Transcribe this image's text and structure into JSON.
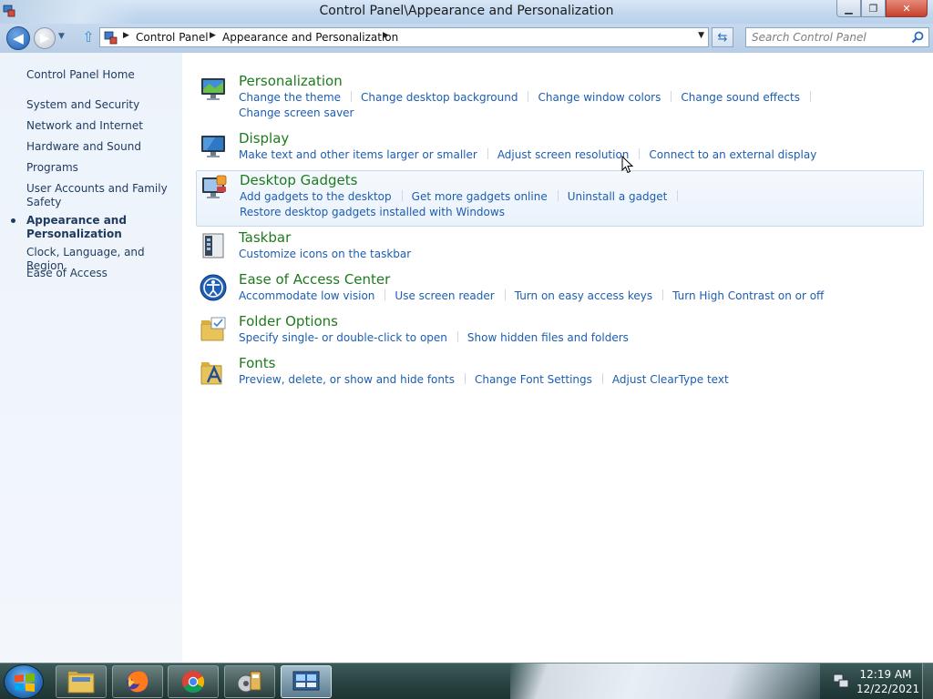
{
  "window": {
    "title": "Control Panel\\Appearance and Personalization"
  },
  "address_bar": {
    "crumbs": [
      "Control Panel",
      "Appearance and Personalization"
    ],
    "search_placeholder": "Search Control Panel"
  },
  "sidebar": {
    "items": [
      {
        "label": "Control Panel Home",
        "current": false
      },
      {
        "label": "System and Security",
        "current": false
      },
      {
        "label": "Network and Internet",
        "current": false
      },
      {
        "label": "Hardware and Sound",
        "current": false
      },
      {
        "label": "Programs",
        "current": false
      },
      {
        "label": "User Accounts and Family Safety",
        "current": false
      },
      {
        "label": "Appearance and Personalization",
        "current": true
      },
      {
        "label": "Clock, Language, and Region",
        "current": false
      },
      {
        "label": "Ease of Access",
        "current": false
      }
    ]
  },
  "categories": [
    {
      "title": "Personalization",
      "icon": "personalization-icon",
      "links": [
        "Change the theme",
        "Change desktop background",
        "Change window colors",
        "Change sound effects",
        "Change screen saver"
      ]
    },
    {
      "title": "Display",
      "icon": "display-icon",
      "links": [
        "Make text and other items larger or smaller",
        "Adjust screen resolution",
        "Connect to an external display"
      ]
    },
    {
      "title": "Desktop Gadgets",
      "icon": "gadgets-icon",
      "hover": true,
      "links": [
        "Add gadgets to the desktop",
        "Get more gadgets online",
        "Uninstall a gadget",
        "Restore desktop gadgets installed with Windows"
      ]
    },
    {
      "title": "Taskbar",
      "icon": "taskbar-icon",
      "links": [
        "Customize icons on the taskbar"
      ]
    },
    {
      "title": "Ease of Access Center",
      "icon": "ease-of-access-icon",
      "links": [
        "Accommodate low vision",
        "Use screen reader",
        "Turn on easy access keys",
        "Turn High Contrast on or off"
      ]
    },
    {
      "title": "Folder Options",
      "icon": "folder-options-icon",
      "links": [
        "Specify single- or double-click to open",
        "Show hidden files and folders"
      ]
    },
    {
      "title": "Fonts",
      "icon": "fonts-icon",
      "links": [
        "Preview, delete, or show and hide fonts",
        "Change Font Settings",
        "Adjust ClearType text"
      ]
    }
  ],
  "taskbar": {
    "pinned": [
      "file-explorer-icon",
      "firefox-icon",
      "chrome-icon",
      "media-app-icon",
      "control-panel-icon"
    ],
    "clock_time": "12:19 AM",
    "clock_date": "12/22/2021"
  },
  "colors": {
    "link": "#1d5db0",
    "category_title": "#1e7a1e",
    "sidebar_text": "#1e3a5f"
  }
}
